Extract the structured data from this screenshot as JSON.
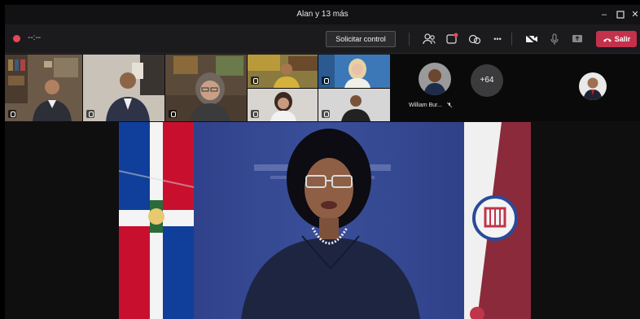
{
  "window": {
    "title": "Alan y 13 más"
  },
  "toolbar": {
    "timer": "--:--",
    "request_control_label": "Solicitar control",
    "more_label": "•••",
    "leave_label": "Salir"
  },
  "gallery": {
    "overflow_count": "+64",
    "named_participant": "William Bur..."
  },
  "colors": {
    "leave": "#c4314b",
    "record": "#e74856",
    "stage_bg": "#2f3f8a"
  }
}
